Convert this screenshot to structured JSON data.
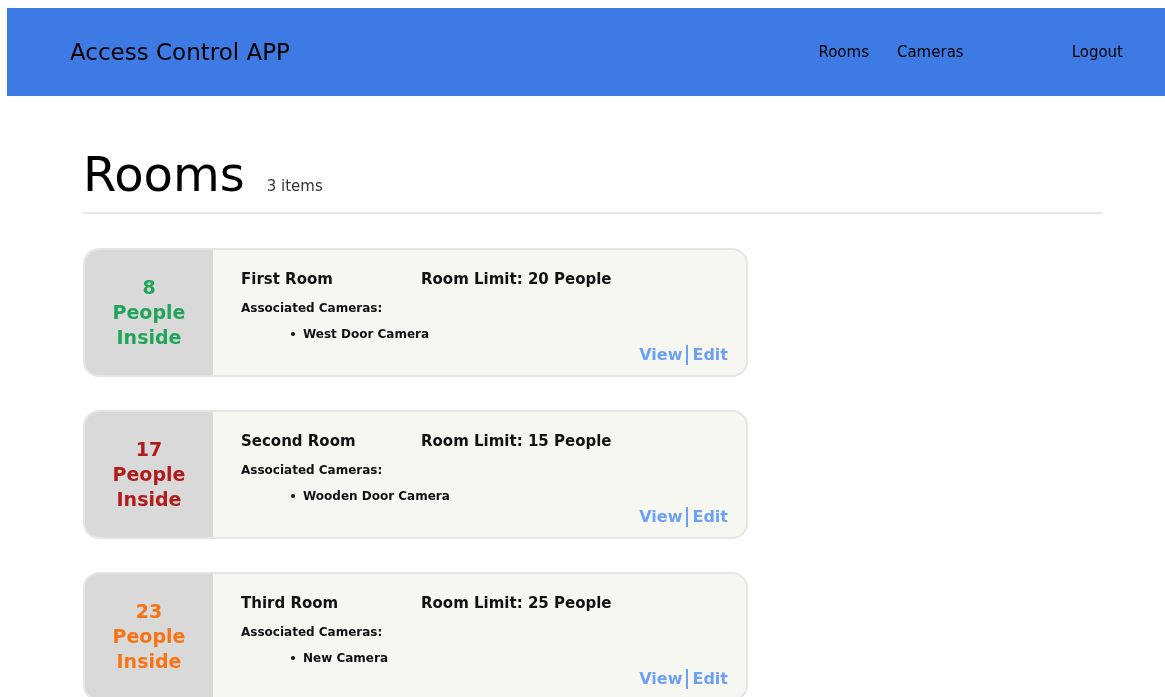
{
  "header": {
    "title": "Access Control APP",
    "nav": [
      {
        "label": "Rooms"
      },
      {
        "label": "Cameras"
      }
    ],
    "logout": "Logout"
  },
  "page": {
    "title": "Rooms",
    "count": "3 items"
  },
  "rooms": [
    {
      "count": "8",
      "count_label": "People Inside",
      "color": "#22a55a",
      "name": "First Room",
      "limit": "Room Limit: 20 People",
      "cameras_label": "Associated Cameras:",
      "cameras": [
        "West Door Camera"
      ],
      "view": "View",
      "edit": "Edit"
    },
    {
      "count": "17",
      "count_label": "People Inside",
      "color": "#b01c1c",
      "name": "Second Room",
      "limit": "Room Limit: 15 People",
      "cameras_label": "Associated Cameras:",
      "cameras": [
        "Wooden Door Camera"
      ],
      "view": "View",
      "edit": "Edit"
    },
    {
      "count": "23",
      "count_label": "People Inside",
      "color": "#f97316",
      "name": "Third Room",
      "limit": "Room Limit: 25 People",
      "cameras_label": "Associated Cameras:",
      "cameras": [
        "New Camera"
      ],
      "view": "View",
      "edit": "Edit"
    }
  ]
}
